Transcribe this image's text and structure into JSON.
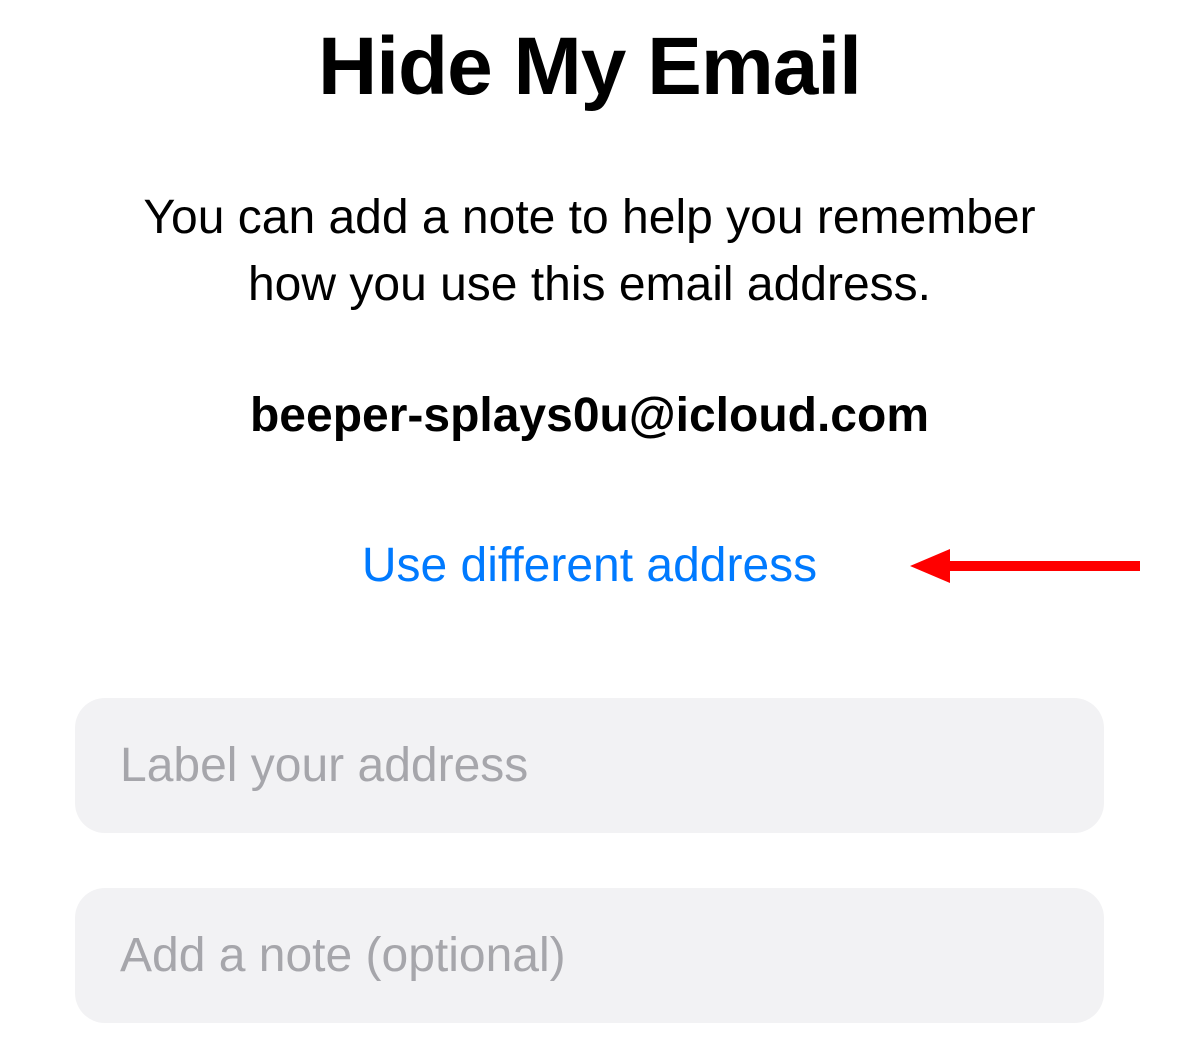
{
  "header": {
    "title": "Hide My Email",
    "subtitle": "You can add a note to help you remember how you use this email address."
  },
  "email": {
    "address": "beeper-splays0u@icloud.com"
  },
  "actions": {
    "use_different_label": "Use different address"
  },
  "inputs": {
    "label_placeholder": "Label your address",
    "label_value": "",
    "note_placeholder": "Add a note (optional)",
    "note_value": ""
  },
  "colors": {
    "link": "#007AFF",
    "input_bg": "#F2F2F4",
    "placeholder": "#A6A6AB",
    "annotation": "#FF0000"
  }
}
